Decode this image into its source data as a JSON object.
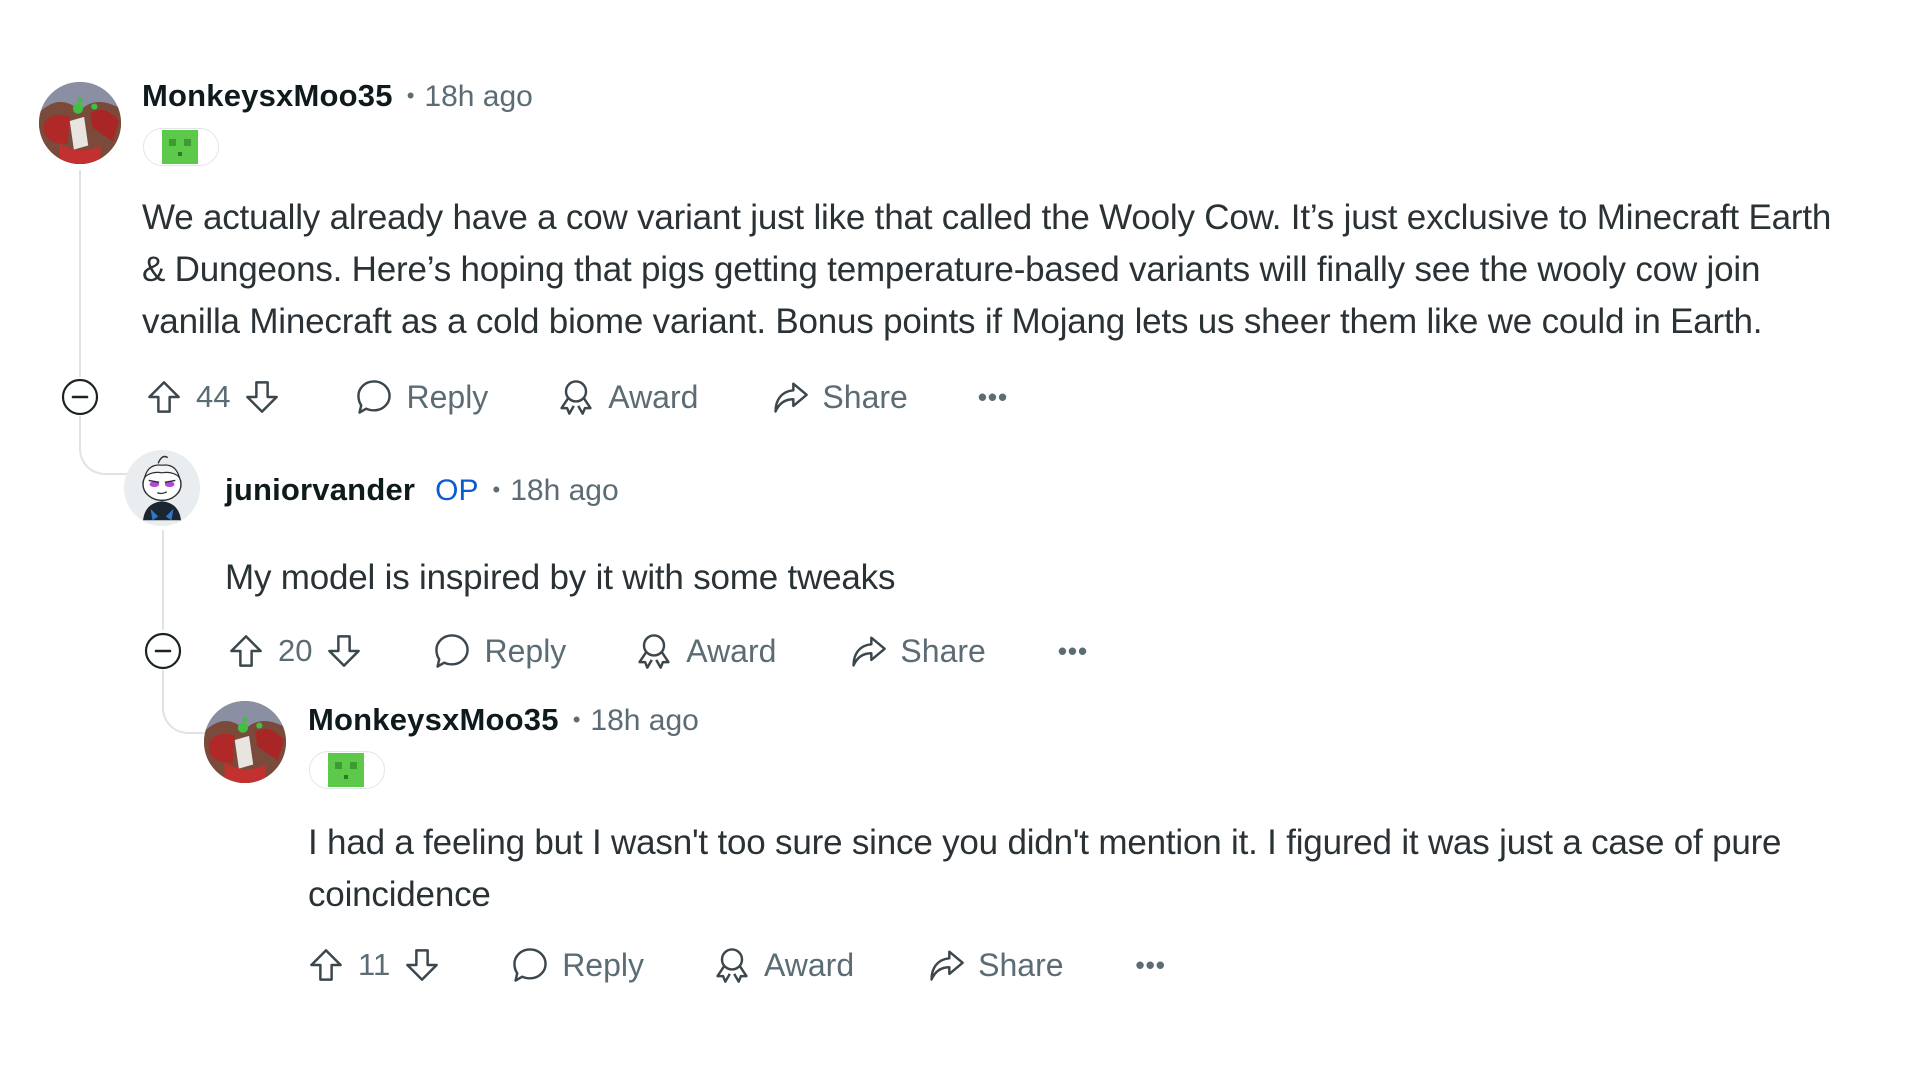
{
  "comments": [
    {
      "username": "MonkeysxMoo35",
      "is_op": false,
      "separator": "•",
      "timestamp": "18h ago",
      "flair_icon": "minecraft-slime-icon",
      "body_lines": [
        "We actually already have a cow variant just like that called the Wooly Cow. It’s just exclusive to Minecraft Earth",
        "& Dungeons. Here’s hoping that pigs getting temperature-based variants will finally see the wooly cow join",
        "vanilla Minecraft as a cold biome variant. Bonus points if Mojang lets us sheer them like we could in Earth."
      ],
      "score": "44",
      "actions": {
        "reply": "Reply",
        "award": "Award",
        "share": "Share",
        "more": "•••"
      }
    },
    {
      "username": "juniorvander",
      "is_op": true,
      "op_label": "OP",
      "separator": "•",
      "timestamp": "18h ago",
      "body_lines": [
        "My model is inspired by it with some tweaks"
      ],
      "score": "20",
      "actions": {
        "reply": "Reply",
        "award": "Award",
        "share": "Share",
        "more": "•••"
      }
    },
    {
      "username": "MonkeysxMoo35",
      "is_op": false,
      "separator": "•",
      "timestamp": "18h ago",
      "flair_icon": "minecraft-slime-icon",
      "body_lines": [
        "I had a feeling but I wasn't too sure since you didn't mention it. I figured it was just a case of pure",
        "coincidence"
      ],
      "score": "11",
      "actions": {
        "reply": "Reply",
        "award": "Award",
        "share": "Share",
        "more": "•••"
      }
    }
  ],
  "colors": {
    "op_badge": "#0a5cd0",
    "meta_text": "#5c6c74",
    "flair_green": "#5cc94a"
  }
}
